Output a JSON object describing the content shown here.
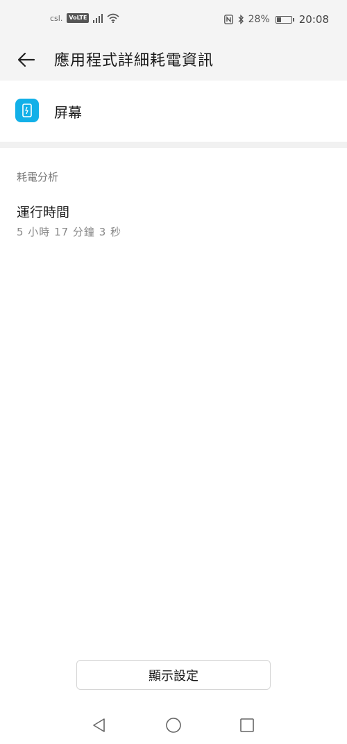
{
  "status_bar": {
    "carrier": "csl.",
    "volte": "VoLTE",
    "battery_percent": "28%",
    "battery_level": 0.28,
    "time": "20:08"
  },
  "header": {
    "title": "應用程式詳細耗電資訊"
  },
  "app": {
    "name": "屏幕"
  },
  "analysis": {
    "section_title": "耗電分析",
    "runtime_label": "運行時間",
    "runtime_value": "5 小時 17 分鐘 3 秒"
  },
  "footer": {
    "display_settings_label": "顯示設定"
  },
  "colors": {
    "app_icon_bg": "#12b0e8",
    "background": "#ffffff",
    "bar_bg": "#f4f4f4"
  }
}
